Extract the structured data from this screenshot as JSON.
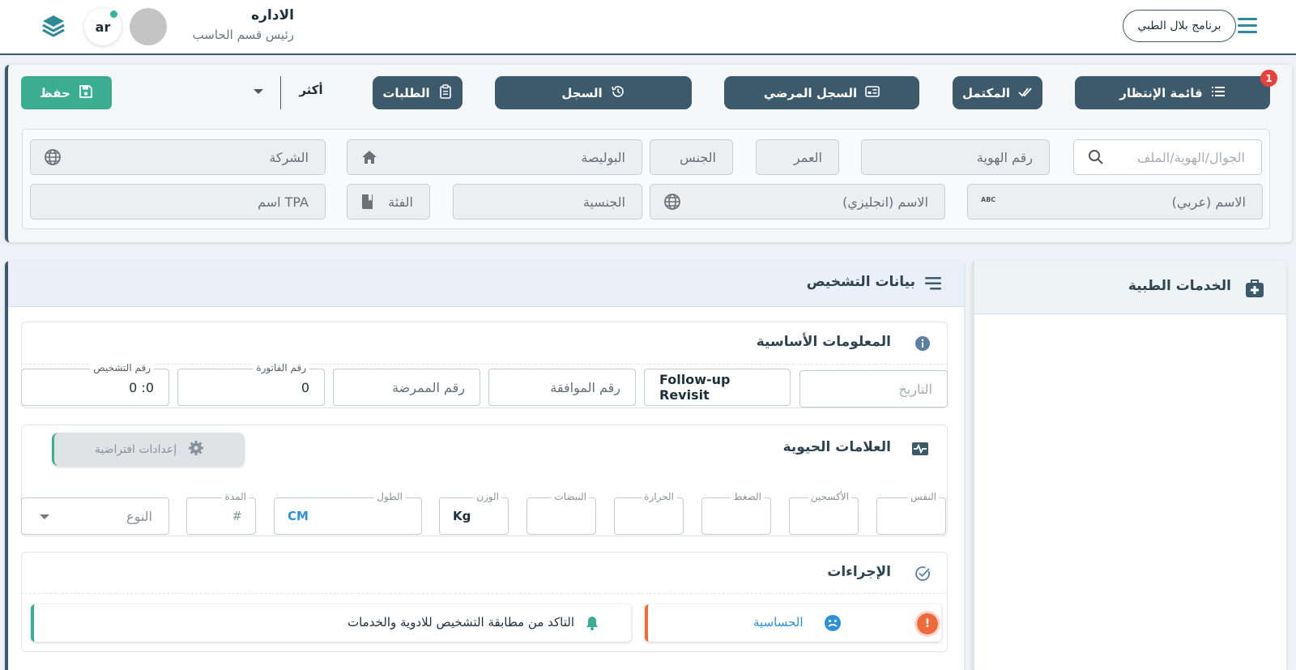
{
  "header": {
    "app_name": "برنامج بلال الطبي",
    "user_name": "الاداره",
    "user_role": "رئيس قسم الحاسب",
    "language": "ar"
  },
  "toolbar": {
    "waiting_list": "قائمة الإنتظار",
    "waiting_badge": "1",
    "completed": "المكتمل",
    "medical_record": "السجل المرضي",
    "log": "السجل",
    "requests": "الطلبات",
    "more": "أكثر",
    "save": "حفظ"
  },
  "patient_fields": {
    "search_placeholder": "الجوال/الهوية/الملف",
    "id_number": "رقم الهوية",
    "age": "العمر",
    "gender": "الجنس",
    "policy": "البوليصة",
    "company": "الشركة",
    "name_ar": "الاسم (عربي)",
    "name_en": "الاسم (انجليزي)",
    "nationality": "الجنسية",
    "category": "الفئة",
    "tpa_name": "اسم TPA"
  },
  "services": {
    "title": "الخدمات الطبية"
  },
  "diagnosis": {
    "title": "بيانات التشخيص",
    "basic_info": {
      "title": "المعلومات الأساسية",
      "date_placeholder": "التاريخ",
      "visit_type": "Follow-up Revisit",
      "approval_placeholder": "رقم الموافقة",
      "nurse_placeholder": "رقم الممرضة",
      "invoice_label": "رقم الفاتورة",
      "invoice_value": "0",
      "diagnosis_label": "رقم التشخيص",
      "diagnosis_value": "0 :0"
    },
    "vitals": {
      "title": "العلامات الحيوية",
      "defaults_button": "إعدادات افتراضية",
      "breath": "النفس",
      "oxygen": "الأكسجين",
      "pressure": "الضغط",
      "temperature": "الحرارة",
      "pulse": "النبضات",
      "weight": "الوزن",
      "weight_unit": "Kg",
      "height": "الطول",
      "height_unit": "CM",
      "duration": "المدة",
      "duration_placeholder": "#",
      "type_placeholder": "النوع"
    },
    "procedures": {
      "title": "الإجراءات",
      "allergy": "الحساسية",
      "check_message": "التاكد من مطابقة التشخيص للادوية والخدمات"
    }
  },
  "colors": {
    "primary": "#3d5a6c",
    "accent_green": "#3bae92",
    "badge_red": "#e8403a",
    "allergy_orange": "#ef6a3a",
    "link_blue": "#2f8fd8"
  }
}
